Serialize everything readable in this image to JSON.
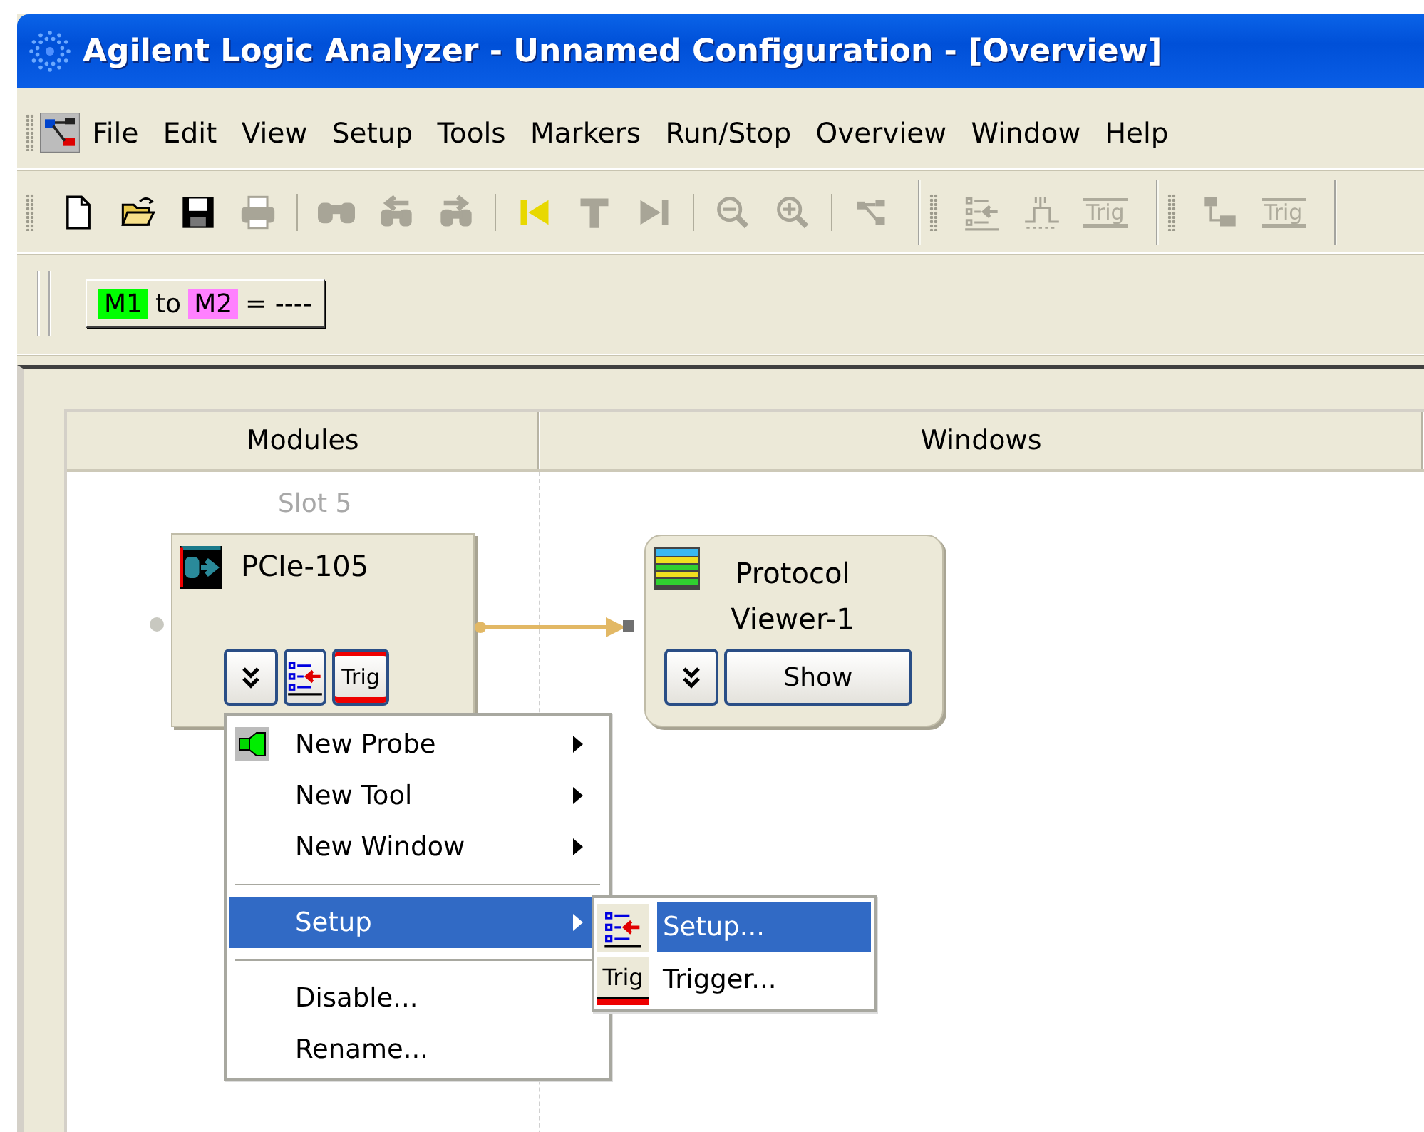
{
  "window": {
    "title": "Agilent Logic Analyzer - Unnamed Configuration - [Overview]"
  },
  "menu_bar": [
    "File",
    "Edit",
    "View",
    "Setup",
    "Tools",
    "Markers",
    "Run/Stop",
    "Overview",
    "Window",
    "Help"
  ],
  "toolbars": [
    {
      "groups": [
        [
          {
            "kind": "new",
            "disabled": false
          },
          {
            "kind": "open",
            "disabled": false
          },
          {
            "kind": "save",
            "disabled": false
          },
          {
            "kind": "print",
            "disabled": true
          }
        ],
        [
          {
            "kind": "find",
            "disabled": true
          },
          {
            "kind": "find-previous",
            "disabled": true
          },
          {
            "kind": "find-next",
            "disabled": true
          }
        ],
        [
          {
            "kind": "go-start",
            "disabled": false
          },
          {
            "kind": "trigger-point",
            "disabled": true
          },
          {
            "kind": "go-end",
            "disabled": true
          }
        ],
        [
          {
            "kind": "zoom-out",
            "disabled": true
          },
          {
            "kind": "zoom-in",
            "disabled": true
          }
        ],
        [
          {
            "kind": "overview",
            "disabled": true
          }
        ]
      ]
    },
    {
      "groups": [
        [
          {
            "kind": "setup",
            "disabled": true
          },
          {
            "kind": "waveform",
            "disabled": true
          },
          {
            "kind": "trig",
            "label": "Trig",
            "disabled": true
          }
        ]
      ]
    },
    {
      "groups": [
        [
          {
            "kind": "modules",
            "disabled": true
          },
          {
            "kind": "trig",
            "label": "Trig",
            "disabled": true
          }
        ]
      ]
    }
  ],
  "marker_button": {
    "markers": [
      {
        "label": "M1",
        "color": "#00ff00"
      },
      {
        "label": "M2",
        "color": "#ff80ff"
      }
    ],
    "connector": "to",
    "value": "= ----"
  },
  "overview": {
    "columns": [
      "Modules",
      "Windows"
    ],
    "module": {
      "slot": "Slot 5",
      "name": "PCIe-105",
      "buttons": [
        {
          "kind": "expand"
        },
        {
          "kind": "setup"
        },
        {
          "kind": "trig",
          "label": "Trig"
        }
      ]
    },
    "window_node": {
      "name": "Protocol Viewer-1",
      "button": "Show"
    },
    "context_menu": [
      {
        "kind": "probe",
        "label": "New Probe",
        "submenu": true,
        "selected": false
      },
      {
        "kind": "item",
        "label": "New Tool",
        "submenu": true,
        "selected": false
      },
      {
        "kind": "item",
        "label": "New Window",
        "submenu": true,
        "selected": false
      },
      {
        "kind": "separator"
      },
      {
        "kind": "item",
        "label": "Setup",
        "submenu": true,
        "selected": true
      },
      {
        "kind": "separator"
      },
      {
        "kind": "item",
        "label": "Disable...",
        "submenu": false,
        "selected": false
      },
      {
        "kind": "item",
        "label": "Rename...",
        "submenu": false,
        "selected": false
      }
    ],
    "submenu": [
      {
        "kind": "setup",
        "label": "Setup...",
        "selected": true
      },
      {
        "kind": "trig",
        "icon_label": "Trig",
        "label": "Trigger...",
        "selected": false
      }
    ]
  }
}
